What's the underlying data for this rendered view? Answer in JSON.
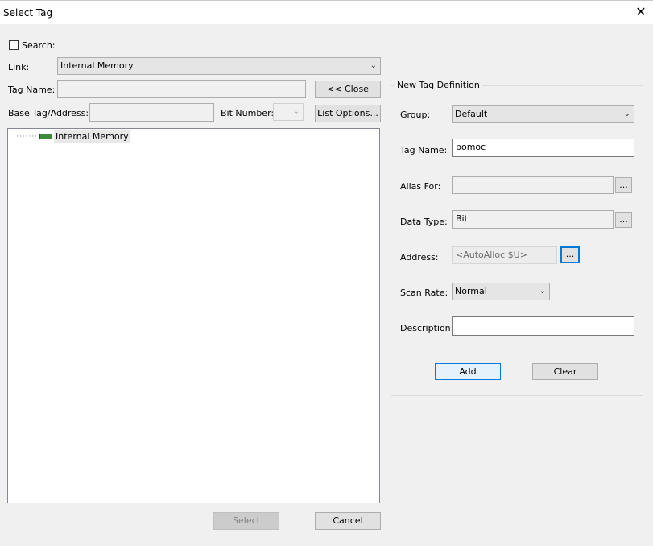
{
  "window": {
    "title": "Select Tag",
    "close_glyph": "✕"
  },
  "search": {
    "label": "Search:",
    "checked": false
  },
  "link": {
    "label": "Link:",
    "value": "Internal Memory"
  },
  "tag_name_search": {
    "label": "Tag Name:",
    "value": ""
  },
  "close_button": {
    "label": "<< Close"
  },
  "base_tag": {
    "label": "Base Tag/Address:",
    "value": ""
  },
  "bit_number": {
    "label": "Bit Number:",
    "value": ""
  },
  "list_options_button": {
    "label": "List Options..."
  },
  "tree": {
    "items": [
      {
        "label": "Internal Memory",
        "icon": "memory-chip-icon",
        "connector": "·······"
      }
    ]
  },
  "bottom": {
    "select_label": "Select",
    "cancel_label": "Cancel"
  },
  "new_tag": {
    "group_title": "New Tag Definition",
    "group": {
      "label": "Group:",
      "value": "Default"
    },
    "tag_name": {
      "label": "Tag Name:",
      "value": "pomoc"
    },
    "alias_for": {
      "label": "Alias For:",
      "value": "",
      "browse": "..."
    },
    "data_type": {
      "label": "Data Type:",
      "value": "Bit",
      "browse": "..."
    },
    "address": {
      "label": "Address:",
      "value": "<AutoAlloc $U>",
      "browse": "..."
    },
    "scan_rate": {
      "label": "Scan Rate:",
      "value": "Normal"
    },
    "description": {
      "label": "Description:",
      "value": ""
    },
    "add_label": "Add",
    "clear_label": "Clear"
  },
  "colors": {
    "accent": "#0078d7",
    "memory_icon": "#3c8c3c"
  }
}
